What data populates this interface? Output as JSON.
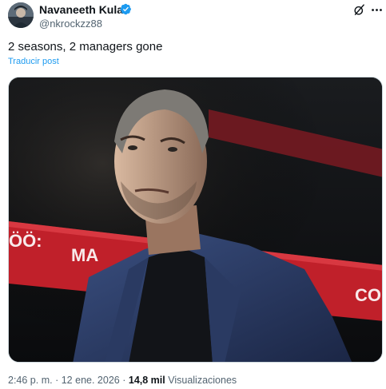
{
  "author": {
    "display_name": "Navaneeth Kulal",
    "handle": "@nkrockzz88",
    "verified": true,
    "verified_color": "#1d9bf0"
  },
  "tweet": {
    "text": "2 seasons, 2 managers gone",
    "translate_label": "Traducir post"
  },
  "meta": {
    "time": "2:46 p. m.",
    "separator": "·",
    "date": "12 ene. 2026",
    "views_count": "14,8 mil",
    "views_label": "Visualizaciones"
  },
  "icons": {
    "avatar": "avatar-photo",
    "verified": "verified-badge-icon",
    "grok": "grok-icon",
    "more": "more-options-icon"
  },
  "colors": {
    "text_primary": "#0f1419",
    "text_secondary": "#536471",
    "link": "#1d9bf0",
    "banner_red": "#c0202a"
  }
}
